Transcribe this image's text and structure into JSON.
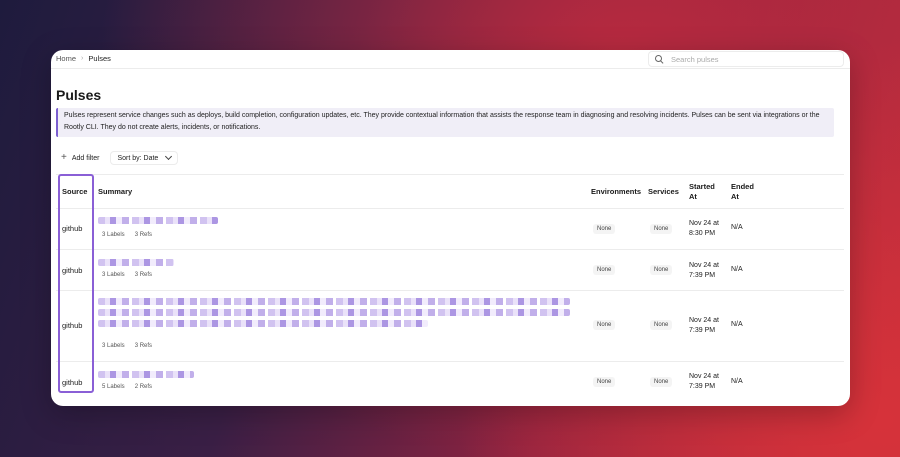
{
  "breadcrumb": {
    "home": "Home",
    "separator": "›",
    "current": "Pulses"
  },
  "search": {
    "placeholder": "Search pulses"
  },
  "page": {
    "title": "Pulses",
    "description": "Pulses represent service changes such as deploys, build completion, configuration updates, etc. They provide contextual information that assists the response team in diagnosing and resolving incidents. Pulses can be sent via integrations or the Rootly CLI. They do not create alerts, incidents, or notifications."
  },
  "filters": {
    "add_filter": "Add filter",
    "sort": "Sort by: Date"
  },
  "table": {
    "headers": {
      "source": "Source",
      "summary": "Summary",
      "environments": "Environments",
      "services": "Services",
      "started_at": "Started At",
      "ended_at": "Ended At"
    },
    "rows": [
      {
        "source": "github",
        "labels": "3 Labels",
        "refs": "3 Refs",
        "environments": "None",
        "services": "None",
        "started_line1": "Nov 24 at",
        "started_line2": "8:30 PM",
        "ended": "N/A"
      },
      {
        "source": "github",
        "labels": "3 Labels",
        "refs": "3 Refs",
        "environments": "None",
        "services": "None",
        "started_line1": "Nov 24 at",
        "started_line2": "7:39 PM",
        "ended": "N/A"
      },
      {
        "source": "github",
        "labels": "3 Labels",
        "refs": "3 Refs",
        "environments": "None",
        "services": "None",
        "started_line1": "Nov 24 at",
        "started_line2": "7:39 PM",
        "ended": "N/A"
      },
      {
        "source": "github",
        "labels": "5 Labels",
        "refs": "2 Refs",
        "environments": "None",
        "services": "None",
        "started_line1": "Nov 24 at",
        "started_line2": "7:39 PM",
        "ended": "N/A"
      }
    ]
  },
  "colors": {
    "accent": "#8a5fd6",
    "info_border": "#7c5fd1",
    "info_bg": "#f0eef7"
  },
  "icons": {
    "search": "search-icon",
    "add": "plus-icon",
    "sort": "chevron-down-icon"
  }
}
